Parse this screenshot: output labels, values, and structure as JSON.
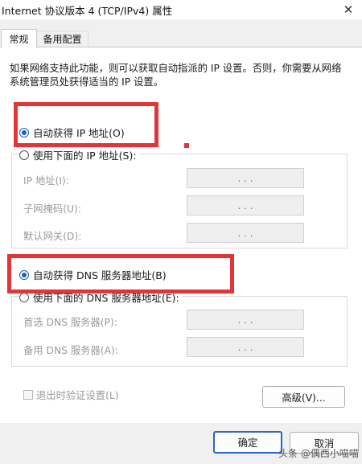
{
  "window": {
    "title": "Internet 协议版本 4 (TCP/IPv4) 属性",
    "close_glyph": "✕"
  },
  "tabs": [
    {
      "label": "常规",
      "active": true
    },
    {
      "label": "备用配置",
      "active": false
    }
  ],
  "description": "如果网络支持此功能，则可以获取自动指派的 IP 设置。否则，你需要从网络系统管理员处获得适当的 IP 设置。",
  "ip_section": {
    "auto_radio": {
      "label": "自动获得 IP 地址(O)",
      "checked": true
    },
    "manual_radio": {
      "label": "使用下面的 IP 地址(S):",
      "checked": false
    },
    "fields": [
      {
        "label": "IP 地址(I):",
        "value": ". . ."
      },
      {
        "label": "子网掩码(U):",
        "value": ". . ."
      },
      {
        "label": "默认网关(D):",
        "value": ". . ."
      }
    ]
  },
  "dns_section": {
    "auto_radio": {
      "label": "自动获得 DNS 服务器地址(B)",
      "checked": true
    },
    "manual_radio": {
      "label": "使用下面的 DNS 服务器地址(E):",
      "checked": false
    },
    "fields": [
      {
        "label": "首选 DNS 服务器(P):",
        "value": ". . ."
      },
      {
        "label": "备用 DNS 服务器(A):",
        "value": ". . ."
      }
    ]
  },
  "validate_checkbox": {
    "label": "退出时验证设置(L)",
    "checked": false
  },
  "buttons": {
    "advanced": "高级(V)...",
    "ok": "确定",
    "cancel": "取消"
  },
  "watermark": "头条 @偶西小喵喵",
  "colors": {
    "highlight_red": "#e2353a",
    "accent_blue": "#1a5fb4"
  }
}
